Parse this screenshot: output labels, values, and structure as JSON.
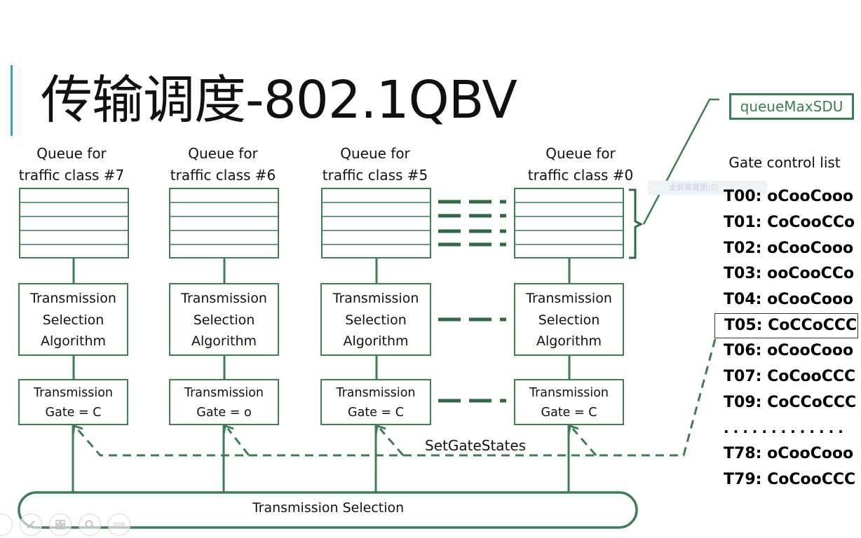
{
  "slide": {
    "title": "传输调度-802.1QBV"
  },
  "colors": {
    "diagram_green": "#3d7d55",
    "dark_green": "#2f6a43",
    "accent_blue": "#2ea3d1",
    "text": "#111111"
  },
  "queues": [
    {
      "label_line1": "Queue for",
      "label_line2": "traffic class #7",
      "algorithm": [
        "Transmission",
        "Selection",
        "Algorithm"
      ],
      "gate_line1": "Transmission",
      "gate_line2": "Gate = C"
    },
    {
      "label_line1": "Queue for",
      "label_line2": "traffic class #6",
      "algorithm": [
        "Transmission",
        "Selection",
        "Algorithm"
      ],
      "gate_line1": "Transmission",
      "gate_line2": "Gate = o"
    },
    {
      "label_line1": "Queue for",
      "label_line2": "traffic class #5",
      "algorithm": [
        "Transmission",
        "Selection",
        "Algorithm"
      ],
      "gate_line1": "Transmission",
      "gate_line2": "Gate = C"
    },
    {
      "label_line1": "Queue for",
      "label_line2": "traffic class #0",
      "algorithm": [
        "Transmission",
        "Selection",
        "Algorithm"
      ],
      "gate_line1": "Transmission",
      "gate_line2": "Gate = C"
    }
  ],
  "set_gate_states_label": "SetGateStates",
  "transmission_selection_label": "Transmission Selection",
  "queue_max_sdu_label": "queueMaxSDU",
  "gate_control_list": {
    "title": "Gate control list",
    "entries": [
      {
        "label": "T00: oCooCooo",
        "highlighted": false
      },
      {
        "label": "T01: CoCooCCo",
        "highlighted": false
      },
      {
        "label": "T02: oCooCooo",
        "highlighted": false
      },
      {
        "label": "T03: ooCooCCo",
        "highlighted": false
      },
      {
        "label": "T04: oCooCooo",
        "highlighted": false
      },
      {
        "label": "T05: CoCCoCCC",
        "highlighted": true
      },
      {
        "label": "T06: oCooCooo",
        "highlighted": false
      },
      {
        "label": "T07: CoCooCCC",
        "highlighted": false
      },
      {
        "label": "T09: CoCCoCCC",
        "highlighted": false
      }
    ],
    "ellipsis": ".............",
    "tail_entries": [
      {
        "label": "T78: oCooCooo"
      },
      {
        "label": "T79: CoCooCCC"
      }
    ]
  },
  "overlay": {
    "screenshot_tip": "全屏幕截图(S)",
    "toolbar_icons": [
      "circle-icon",
      "pen-icon",
      "slides-icon",
      "zoom-icon",
      "more-icon"
    ],
    "more_glyph": "ooo"
  }
}
